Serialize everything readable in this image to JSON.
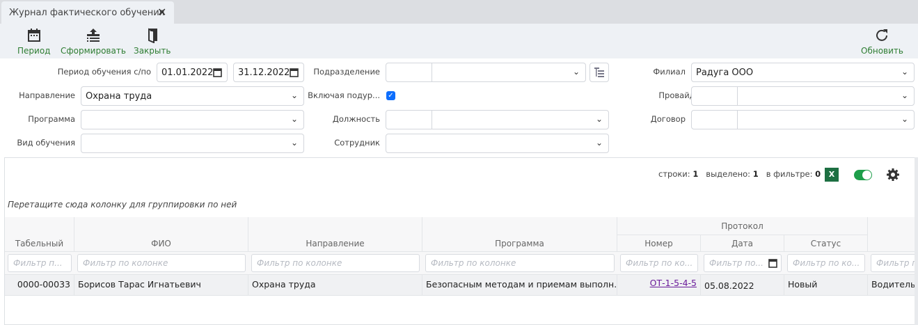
{
  "tab": {
    "title": "Журнал фактического обучения"
  },
  "toolbar": {
    "period": "Период",
    "generate": "Сформировать",
    "close": "Закрыть",
    "refresh": "Обновить"
  },
  "filters": {
    "period_label": "Период обучения с/по",
    "date_from": "01.01.2022",
    "date_to": "31.12.2022",
    "direction_label": "Направление",
    "direction_value": "Охрана труда",
    "program_label": "Программа",
    "program_value": "",
    "training_type_label": "Вид обучения",
    "training_type_value": "",
    "department_label": "Подразделение",
    "department_value": "",
    "include_sub_label": "Включая подур...",
    "include_sub_checked": true,
    "position_label": "Должность",
    "position_value": "",
    "employee_label": "Сотрудник",
    "employee_value": "",
    "branch_label": "Филиал",
    "branch_value": "Радуга ООО",
    "provider_label": "Провайдер",
    "provider_value": "",
    "contract_label": "Договор",
    "contract_value": ""
  },
  "grid": {
    "rows_label": "строки:",
    "rows": "1",
    "selected_label": "выделено:",
    "selected": "1",
    "filtered_label": "в фильтре:",
    "filtered": "0",
    "excel_label": "X",
    "group_hint": "Перетащите сюда колонку для группировки по ней",
    "group_header": "Протокол",
    "columns": [
      "Табельный",
      "ФИО",
      "Направление",
      "Программа",
      "Номер",
      "Дата",
      "Статус"
    ],
    "filter_placeholders": [
      "Фильтр п...",
      "Фильтр по колонке",
      "Фильтр по колонке",
      "Фильтр по колонке",
      "Фильтр по ко...",
      "Фильтр по...",
      "Фильтр по ко...",
      "Фильтр п"
    ],
    "rows_data": [
      [
        "0000-00033",
        "Борисов Тарас Игнатьевич",
        "Охрана труда",
        "Безопасным методам и приемам выполн...",
        "ОТ-1-5-4-5",
        "05.08.2022",
        "Новый",
        "Водитель"
      ]
    ]
  },
  "colors": {
    "accent": "#2e7d32",
    "link": "#6a1b9a",
    "checkbox": "#0d6efd",
    "excel": "#1d6f42"
  }
}
